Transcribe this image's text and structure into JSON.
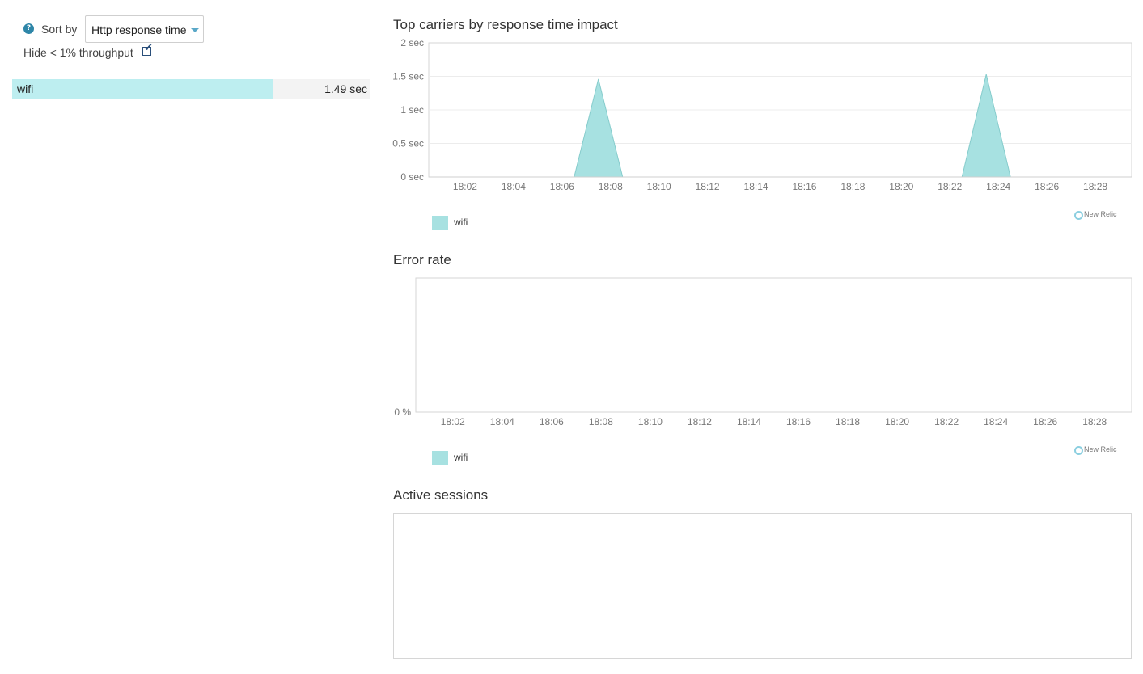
{
  "controls": {
    "help_icon": "?",
    "sort_label": "Sort by",
    "sort_value": "Http response time",
    "hide_label": "Hide < 1% throughput",
    "hide_checked": true
  },
  "carriers": [
    {
      "name": "wifi",
      "value": "1.49 sec",
      "fraction": 0.73
    }
  ],
  "colors": {
    "series": "#a7e1e1",
    "series_stroke": "#86cccc",
    "row_fill": "#bdeef0",
    "accent": "#2e86a8"
  },
  "branding": "New Relic",
  "chart_data": [
    {
      "type": "area",
      "title": "Top carriers by response time impact",
      "x_ticks": [
        "18:02",
        "18:04",
        "18:06",
        "18:08",
        "18:10",
        "18:12",
        "18:14",
        "18:16",
        "18:18",
        "18:20",
        "18:22",
        "18:24",
        "18:26",
        "18:28"
      ],
      "y_ticks": [
        "0 sec",
        "0.5 sec",
        "1 sec",
        "1.5 sec",
        "2 sec"
      ],
      "ylim": [
        0,
        2
      ],
      "grid": true,
      "legend": "bottom-left",
      "series": [
        {
          "name": "wifi",
          "x": [
            "18:06:30",
            "18:07:30",
            "18:08:30",
            "18:22:30",
            "18:23:30",
            "18:24:30"
          ],
          "y": [
            0,
            1.46,
            0,
            0,
            1.53,
            0
          ]
        }
      ]
    },
    {
      "type": "area",
      "title": "Error rate",
      "x_ticks": [
        "18:02",
        "18:04",
        "18:06",
        "18:08",
        "18:10",
        "18:12",
        "18:14",
        "18:16",
        "18:18",
        "18:20",
        "18:22",
        "18:24",
        "18:26",
        "18:28"
      ],
      "y_ticks": [
        "0 %"
      ],
      "grid": false,
      "legend": "bottom-left",
      "series": [
        {
          "name": "wifi",
          "x": [],
          "y": []
        }
      ]
    },
    {
      "type": "area",
      "title": "Active sessions",
      "series": []
    }
  ]
}
